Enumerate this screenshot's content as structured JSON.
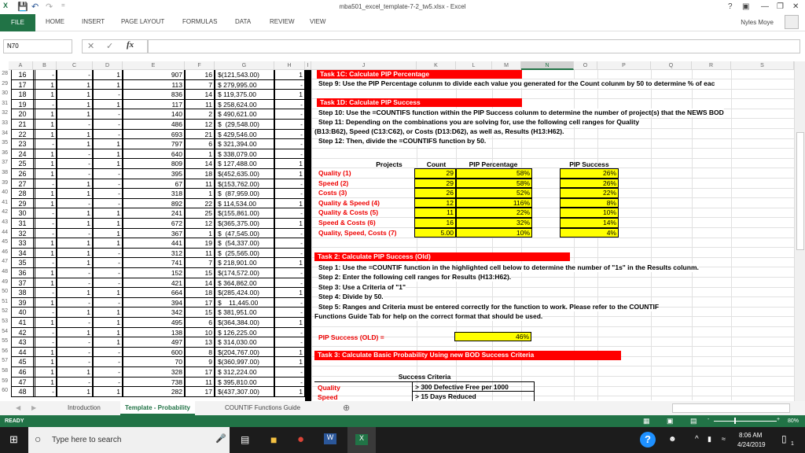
{
  "window": {
    "title": "mba501_excel_template-7-2_tw5.xlsx - Excel",
    "help": "?",
    "user": "Nyles Moye"
  },
  "ribbon": {
    "tabs": [
      "FILE",
      "HOME",
      "INSERT",
      "PAGE LAYOUT",
      "FORMULAS",
      "DATA",
      "REVIEW",
      "VIEW"
    ]
  },
  "formula_bar": {
    "name_box": "N70",
    "fx": "fx",
    "value": ""
  },
  "columns": [
    "A",
    "B",
    "C",
    "D",
    "E",
    "F",
    "G",
    "H",
    "I",
    "J",
    "K",
    "L",
    "M",
    "N",
    "O",
    "P",
    "Q",
    "R",
    "S"
  ],
  "selected_column": "N",
  "rows": [
    {
      "r": "28",
      "a": "16",
      "b": "-",
      "c": "-",
      "d": "1",
      "e": "907",
      "f": "16",
      "g": "$(121,543.00)",
      "h": "1"
    },
    {
      "r": "29",
      "a": "17",
      "b": "1",
      "c": "1",
      "d": "1",
      "e": "113",
      "f": "7",
      "g": "$ 279,995.00",
      "h": "-"
    },
    {
      "r": "30",
      "a": "18",
      "b": "1",
      "c": "1",
      "d": "-",
      "e": "836",
      "f": "14",
      "g": "$ 119,375.00",
      "h": "1"
    },
    {
      "r": "31",
      "a": "19",
      "b": "-",
      "c": "1",
      "d": "1",
      "e": "117",
      "f": "11",
      "g": "$ 258,624.00",
      "h": "-"
    },
    {
      "r": "32",
      "a": "20",
      "b": "1",
      "c": "1",
      "d": "-",
      "e": "140",
      "f": "2",
      "g": "$ 490,621.00",
      "h": "-"
    },
    {
      "r": "33",
      "a": "21",
      "b": "1",
      "c": "-",
      "d": "-",
      "e": "486",
      "f": "12",
      "g": "$  (29,548.00)",
      "h": "-"
    },
    {
      "r": "34",
      "a": "22",
      "b": "1",
      "c": "1",
      "d": "-",
      "e": "693",
      "f": "21",
      "g": "$ 429,546.00",
      "h": "-"
    },
    {
      "r": "35",
      "a": "23",
      "b": "-",
      "c": "1",
      "d": "1",
      "e": "797",
      "f": "6",
      "g": "$ 321,394.00",
      "h": "-"
    },
    {
      "r": "36",
      "a": "24",
      "b": "1",
      "c": "-",
      "d": "1",
      "e": "640",
      "f": "1",
      "g": "$ 338,079.00",
      "h": "-"
    },
    {
      "r": "37",
      "a": "25",
      "b": "1",
      "c": "-",
      "d": "1",
      "e": "809",
      "f": "14",
      "g": "$ 127,488.00",
      "h": "1"
    },
    {
      "r": "38",
      "a": "26",
      "b": "1",
      "c": "-",
      "d": "-",
      "e": "395",
      "f": "18",
      "g": "$(452,635.00)",
      "h": "1"
    },
    {
      "r": "39",
      "a": "27",
      "b": "-",
      "c": "1",
      "d": "-",
      "e": "67",
      "f": "11",
      "g": "$(153,762.00)",
      "h": "-"
    },
    {
      "r": "40",
      "a": "28",
      "b": "1",
      "c": "1",
      "d": "-",
      "e": "318",
      "f": "1",
      "g": "$  (87,959.00)",
      "h": "-"
    },
    {
      "r": "41",
      "a": "29",
      "b": "1",
      "c": "-",
      "d": "-",
      "e": "892",
      "f": "22",
      "g": "$ 114,534.00",
      "h": "1"
    },
    {
      "r": "42",
      "a": "30",
      "b": "-",
      "c": "1",
      "d": "1",
      "e": "241",
      "f": "25",
      "g": "$(155,861.00)",
      "h": "-"
    },
    {
      "r": "43",
      "a": "31",
      "b": "-",
      "c": "1",
      "d": "1",
      "e": "672",
      "f": "12",
      "g": "$(365,375.00)",
      "h": "1"
    },
    {
      "r": "44",
      "a": "32",
      "b": "-",
      "c": "-",
      "d": "1",
      "e": "367",
      "f": "1",
      "g": "$  (47,545.00)",
      "h": "-"
    },
    {
      "r": "45",
      "a": "33",
      "b": "1",
      "c": "1",
      "d": "1",
      "e": "441",
      "f": "19",
      "g": "$  (54,337.00)",
      "h": "-"
    },
    {
      "r": "46",
      "a": "34",
      "b": "1",
      "c": "1",
      "d": "-",
      "e": "312",
      "f": "11",
      "g": "$  (25,565.00)",
      "h": "-"
    },
    {
      "r": "47",
      "a": "35",
      "b": "-",
      "c": "1",
      "d": "-",
      "e": "741",
      "f": "7",
      "g": "$ 218,901.00",
      "h": "1"
    },
    {
      "r": "48",
      "a": "36",
      "b": "1",
      "c": "-",
      "d": "-",
      "e": "152",
      "f": "15",
      "g": "$(174,572.00)",
      "h": "-"
    },
    {
      "r": "49",
      "a": "37",
      "b": "1",
      "c": "-",
      "d": "-",
      "e": "421",
      "f": "14",
      "g": "$ 364,862.00",
      "h": "-"
    },
    {
      "r": "50",
      "a": "38",
      "b": "-",
      "c": "1",
      "d": "1",
      "e": "664",
      "f": "18",
      "g": "$(285,424.00)",
      "h": "1"
    },
    {
      "r": "51",
      "a": "39",
      "b": "1",
      "c": "-",
      "d": "-",
      "e": "394",
      "f": "17",
      "g": "$    11,445.00",
      "h": "-"
    },
    {
      "r": "52",
      "a": "40",
      "b": "-",
      "c": "1",
      "d": "1",
      "e": "342",
      "f": "15",
      "g": "$ 381,951.00",
      "h": "-"
    },
    {
      "r": "53",
      "a": "41",
      "b": "1",
      "c": "-",
      "d": "1",
      "e": "495",
      "f": "6",
      "g": "$(364,384.00)",
      "h": "1"
    },
    {
      "r": "54",
      "a": "42",
      "b": "-",
      "c": "1",
      "d": "1",
      "e": "138",
      "f": "10",
      "g": "$ 126,225.00",
      "h": "-"
    },
    {
      "r": "55",
      "a": "43",
      "b": "-",
      "c": "-",
      "d": "1",
      "e": "497",
      "f": "13",
      "g": "$ 314,030.00",
      "h": "-"
    },
    {
      "r": "56",
      "a": "44",
      "b": "1",
      "c": "-",
      "d": "-",
      "e": "600",
      "f": "8",
      "g": "$(204,767.00)",
      "h": "1"
    },
    {
      "r": "57",
      "a": "45",
      "b": "1",
      "c": "-",
      "d": "-",
      "e": "70",
      "f": "9",
      "g": "$(360,997.00)",
      "h": "1"
    },
    {
      "r": "58",
      "a": "46",
      "b": "1",
      "c": "1",
      "d": "-",
      "e": "328",
      "f": "17",
      "g": "$ 312,224.00",
      "h": "-"
    },
    {
      "r": "59",
      "a": "47",
      "b": "1",
      "c": "-",
      "d": "-",
      "e": "738",
      "f": "11",
      "g": "$ 395,810.00",
      "h": "-"
    },
    {
      "r": "60",
      "a": "48",
      "b": "-",
      "c": "1",
      "d": "1",
      "e": "282",
      "f": "17",
      "g": "$(437,307.00)",
      "h": "1"
    }
  ],
  "task1c": {
    "title": "Task 1C:  Calculate PIP Percentage",
    "step9": "Step 9: Use the PIP Percentage colunm to divide each value you generated for the Count colunm by 50 to determine % of eac"
  },
  "task1d": {
    "title": "Task 1D:  Calculate PIP Success",
    "step10": "Step 10: Use the =COUNTIFS function within the PIP Success colunm to determine the number of project(s) that the NEWS BOD",
    "step11a": "Step 11: Depending on the combinations you are solving for, use the following cell ranges for Quality",
    "step11b": "(B13:B62), Speed (C13:C62), or Costs (D13:D62), as well as, Results (H13:H62).",
    "step12": "Step 12: Then, divide the =COUNTIFS function by 50."
  },
  "pip_table": {
    "headers": {
      "projects": "Projects",
      "count": "Count",
      "pct": "PIP Percentage",
      "success": "PIP Success"
    },
    "rows": [
      {
        "project": "Quality (1)",
        "count": "29",
        "pct": "58%",
        "success": "26%"
      },
      {
        "project": "Speed (2)",
        "count": "29",
        "pct": "58%",
        "success": "26%"
      },
      {
        "project": "Costs (3)",
        "count": "26",
        "pct": "52%",
        "success": "22%"
      },
      {
        "project": "Quality & Speed (4)",
        "count": "12",
        "pct": "116%",
        "success": "8%"
      },
      {
        "project": "Quality & Costs (5)",
        "count": "11",
        "pct": "22%",
        "success": "10%"
      },
      {
        "project": "Speed & Costs (6)",
        "count": "16",
        "pct": "32%",
        "success": "14%"
      },
      {
        "project": "Quality, Speed, Costs (7)",
        "count": "5.00",
        "pct": "10%",
        "success": "4%"
      }
    ]
  },
  "task2": {
    "title": "Task 2:  Calculate PIP Success (Old)",
    "steps": [
      "Step 1: Use the =COUNTIF function in the highlighted cell below to determine the number of \"1s\" in the Results colunm.",
      "Step 2: Enter the following cell ranges for Results (H13:H62).",
      "Step 3: Use a Criteria of \"1\"",
      "Step 4: Divide by 50.",
      "Step 5: Ranges and Criteria must be entered correctly for the function to work. Please refer to the COUNTIF",
      "Functions Guide Tab for help on the correct format that should be used."
    ],
    "result_label": "PIP Success (OLD) =",
    "result_value": "46%"
  },
  "task3": {
    "title": "Task 3: Calculate Basic Probability Using new BOD Success Criteria",
    "criteria_header": "Success Criteria",
    "criteria": [
      {
        "label": "Quality",
        "value": "> 300 Defective Free per 1000"
      },
      {
        "label": "Speed",
        "value": "> 15 Days Reduced"
      }
    ]
  },
  "sheet_tabs": {
    "tabs": [
      "Introduction",
      "Template - Probability",
      "COUNTIF Functions Guide"
    ],
    "active": "Template - Probability"
  },
  "status": {
    "ready": "READY",
    "zoom": "80%"
  },
  "taskbar": {
    "search_placeholder": "Type here to search",
    "time": "8:06 AM",
    "date": "4/24/2019",
    "notifications": "1"
  }
}
